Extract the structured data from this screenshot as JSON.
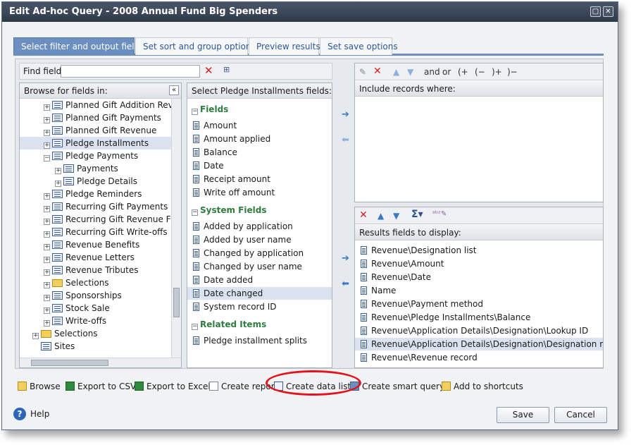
{
  "window": {
    "title": "Edit Ad-hoc Query - 2008 Annual Fund Big Spenders"
  },
  "tabs": [
    "Select filter and output fields",
    "Set sort and group options",
    "Preview results",
    "Set save options"
  ],
  "find": {
    "label": "Find field:",
    "value": ""
  },
  "browse": {
    "header": "Browse for fields in:",
    "collapse": "«",
    "items": [
      {
        "label": "Planned Gift Addition Reven",
        "type": "table",
        "level": 1,
        "node": "+"
      },
      {
        "label": "Planned Gift Payments",
        "type": "table",
        "level": 1,
        "node": "+"
      },
      {
        "label": "Planned Gift Revenue",
        "type": "table",
        "level": 1,
        "node": "+"
      },
      {
        "label": "Pledge Installments",
        "type": "table",
        "level": 1,
        "node": "+",
        "selected": true
      },
      {
        "label": "Pledge Payments",
        "type": "table",
        "level": 1,
        "node": "−"
      },
      {
        "label": "Payments",
        "type": "table",
        "level": 2,
        "node": "+"
      },
      {
        "label": "Pledge Details",
        "type": "table",
        "level": 2,
        "node": "+"
      },
      {
        "label": "Pledge Reminders",
        "type": "table",
        "level": 1,
        "node": "+"
      },
      {
        "label": "Recurring Gift Payments",
        "type": "table",
        "level": 1,
        "node": "+"
      },
      {
        "label": "Recurring Gift Revenue Func",
        "type": "table",
        "level": 1,
        "node": "+"
      },
      {
        "label": "Recurring Gift Write-offs",
        "type": "table",
        "level": 1,
        "node": "+"
      },
      {
        "label": "Revenue Benefits",
        "type": "table",
        "level": 1,
        "node": "+"
      },
      {
        "label": "Revenue Letters",
        "type": "table",
        "level": 1,
        "node": "+"
      },
      {
        "label": "Revenue Tributes",
        "type": "table",
        "level": 1,
        "node": "+"
      },
      {
        "label": "Selections",
        "type": "folder",
        "level": 1,
        "node": "+"
      },
      {
        "label": "Sponsorships",
        "type": "table",
        "level": 1,
        "node": "+"
      },
      {
        "label": "Stock Sale",
        "type": "table",
        "level": 1,
        "node": "+"
      },
      {
        "label": "Write-offs",
        "type": "table",
        "level": 1,
        "node": "+"
      },
      {
        "label": "Selections",
        "type": "folder",
        "level": 0,
        "node": "+"
      },
      {
        "label": "Sites",
        "type": "table",
        "level": 0,
        "node": ""
      }
    ]
  },
  "fields": {
    "header": "Select Pledge Installments fields:",
    "sections": [
      {
        "title": "Fields",
        "items": [
          "Amount",
          "Amount applied",
          "Balance",
          "Date",
          "Receipt amount",
          "Write off amount"
        ]
      },
      {
        "title": "System Fields",
        "items": [
          "Added by application",
          "Added by user name",
          "Changed by application",
          "Changed by user name",
          "Date added",
          "Date changed",
          "System record ID"
        ]
      },
      {
        "title": "Related Items",
        "items": [
          "Pledge installment splits"
        ]
      }
    ],
    "selected": "Date changed"
  },
  "filter_toolbar": {
    "and": "and",
    "or": "or",
    "open_paren": "(+",
    "close_paren_minus": "(−",
    ")plus": ")+",
    "close_minus": ")−"
  },
  "include": {
    "header": "Include records where:"
  },
  "results": {
    "header": "Results fields to display:",
    "items": [
      "Revenue\\Designation list",
      "Revenue\\Amount",
      "Revenue\\Date",
      "Name",
      "Revenue\\Payment method",
      "Revenue\\Pledge Installments\\Balance",
      "Revenue\\Application Details\\Designation\\Lookup ID",
      "Revenue\\Application Details\\Designation\\Designation record",
      "Revenue\\Revenue record"
    ],
    "selected": "Revenue\\Application Details\\Designation\\Designation record"
  },
  "actions": [
    "Browse",
    "Export to CSV",
    "Export to Excel",
    "Create report",
    "Create data list",
    "Create smart query",
    "Add to shortcuts"
  ],
  "highlight_color": "#e0141e",
  "footer": {
    "help": "Help",
    "save": "Save",
    "cancel": "Cancel"
  }
}
